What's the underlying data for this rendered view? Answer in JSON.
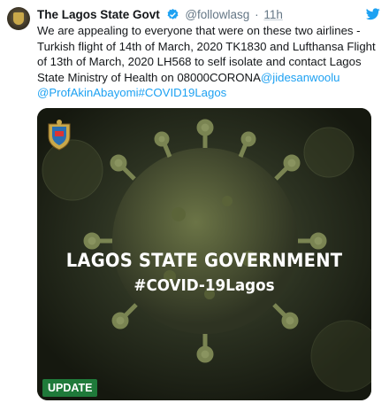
{
  "tweet": {
    "author_name": "The Lagos State Govt",
    "handle": "@followlasg",
    "separator": "·",
    "time": "11h",
    "text": "We are appealing to everyone that were on these two airlines - Turkish flight of 14th of March, 2020 TK1830 and Lufthansa Flight of 13th of March, 2020 LH568 to self isolate and contact Lagos State Ministry of Health on 08000CORONA",
    "mentions": [
      "@jidesanwoolu",
      "@ProfAkinAbayomi"
    ],
    "hashtag": "#COVID19Lagos"
  },
  "media": {
    "headline": "LAGOS STATE GOVERNMENT",
    "hashtag": "#COVID-19Lagos",
    "badge": "UPDATE"
  },
  "icons": {
    "verified": "verified-badge-icon",
    "twitter": "twitter-bird-icon",
    "crest": "lagos-crest-icon"
  },
  "colors": {
    "link": "#1da1f2",
    "verified": "#1da1f2",
    "badge": "#1f7a3a",
    "image_bg": "#1c2016"
  }
}
